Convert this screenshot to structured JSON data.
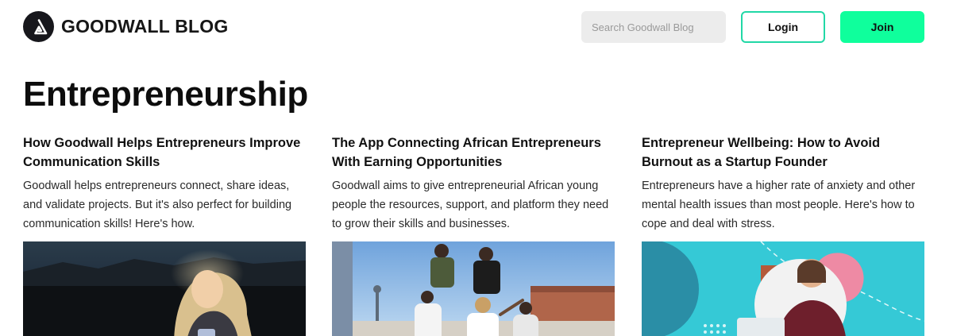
{
  "header": {
    "brand": "GOODWALL BLOG",
    "search": {
      "placeholder": "Search Goodwall Blog",
      "value": ""
    },
    "login_label": "Login",
    "join_label": "Join"
  },
  "page": {
    "title": "Entrepreneurship"
  },
  "articles": [
    {
      "title": "How Goodwall Helps Entrepreneurs Improve Communication Skills",
      "excerpt": "Goodwall helps entrepreneurs connect, share ideas, and validate projects. But it's also perfect for building communication skills! Here's how."
    },
    {
      "title": "The App Connecting African Entrepreneurs With Earning Opportunities",
      "excerpt": "Goodwall aims to give entrepreneurial African young people the resources, support, and platform they need to grow their skills and businesses."
    },
    {
      "title": "Entrepreneur Wellbeing: How to Avoid Burnout as a Startup Founder",
      "excerpt": "Entrepreneurs have a higher rate of anxiety and other mental health issues than most people. Here's how to cope and deal with stress."
    }
  ],
  "colors": {
    "login_border": "#21d8a6",
    "join_bg": "#0fff9c",
    "search_bg": "#ececec",
    "logo_bg": "#17171c"
  }
}
